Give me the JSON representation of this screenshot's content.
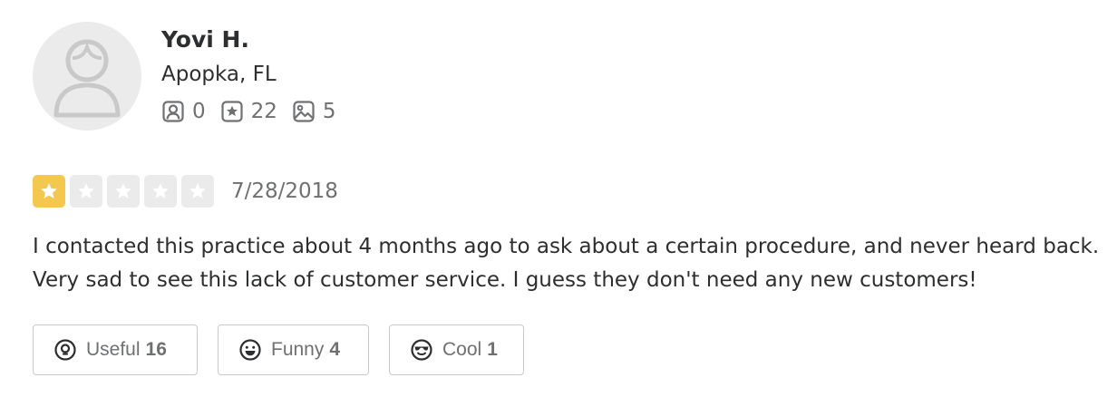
{
  "user": {
    "name": "Yovi H.",
    "location": "Apopka, FL",
    "stats": {
      "friends": {
        "icon": "friends-icon",
        "value": "0"
      },
      "reviews": {
        "icon": "reviews-icon",
        "value": "22"
      },
      "photos": {
        "icon": "photos-icon",
        "value": "5"
      }
    }
  },
  "review": {
    "rating": 1,
    "max_rating": 5,
    "date": "7/28/2018",
    "text": "I contacted this practice about 4 months ago to ask about a certain procedure, and never heard back. Very sad to see this lack of customer service. I guess they don't need any new customers!"
  },
  "reactions": {
    "useful": {
      "label": "Useful",
      "count": "16",
      "icon": "lightbulb-icon"
    },
    "funny": {
      "label": "Funny",
      "count": "4",
      "icon": "smile-icon"
    },
    "cool": {
      "label": "Cool",
      "count": "1",
      "icon": "sunglasses-icon"
    }
  },
  "colors": {
    "star_filled": "#f4c84f",
    "star_empty": "#ebebeb",
    "text_primary": "#2d2e2f",
    "text_secondary": "#6e7072",
    "border": "#c8c9ca"
  }
}
